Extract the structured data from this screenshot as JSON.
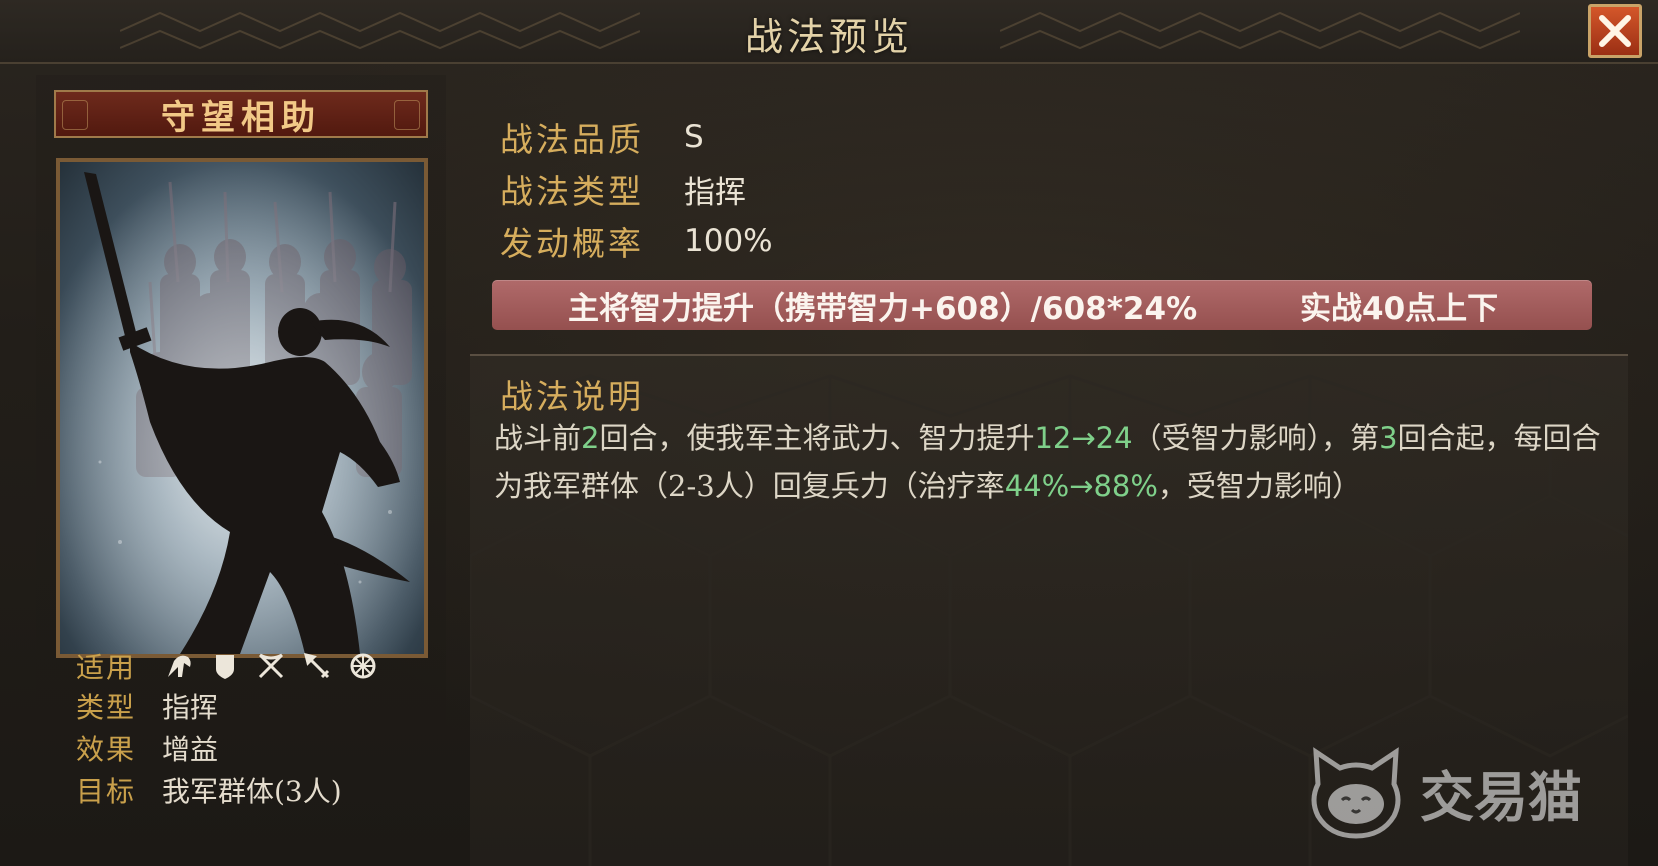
{
  "window": {
    "title": "战法预览"
  },
  "skill": {
    "name": "守望相助",
    "meta": [
      {
        "label": "适用",
        "value": ""
      },
      {
        "label": "类型",
        "value": "指挥"
      },
      {
        "label": "效果",
        "value": "增益"
      },
      {
        "label": "目标",
        "value": "我军群体(3人)"
      }
    ],
    "troop_icons": [
      "cavalry-icon",
      "shield-infantry-icon",
      "archer-icon",
      "spear-icon",
      "siege-icon"
    ]
  },
  "info": [
    {
      "label": "战法品质",
      "value": "S"
    },
    {
      "label": "战法类型",
      "value": "指挥"
    },
    {
      "label": "发动概率",
      "value": "100%"
    }
  ],
  "highlight": {
    "left_text": "主将智力提升（携带智力+608）/608*24%",
    "right_text": "实战40点上下"
  },
  "description": {
    "title": "战法说明",
    "segments": [
      {
        "text": "战斗前",
        "green": false
      },
      {
        "text": "2",
        "green": true
      },
      {
        "text": "回合，使我军主将武力、智力提升",
        "green": false
      },
      {
        "text": "12→24",
        "green": true
      },
      {
        "text": "（受智力影响），第",
        "green": false
      },
      {
        "text": "3",
        "green": true
      },
      {
        "text": "回合起，每回合为我军群体（2-3人）回复兵力（治疗率",
        "green": false
      },
      {
        "text": "44%→88%",
        "green": true
      },
      {
        "text": "，受智力影响）",
        "green": false
      }
    ]
  },
  "watermark": {
    "text": "交易猫"
  },
  "colors": {
    "gold_label": "#d6ad5d",
    "highlight_bar": "#a55e5e",
    "green_value": "#7fd08a",
    "close_button": "#c14a22"
  }
}
